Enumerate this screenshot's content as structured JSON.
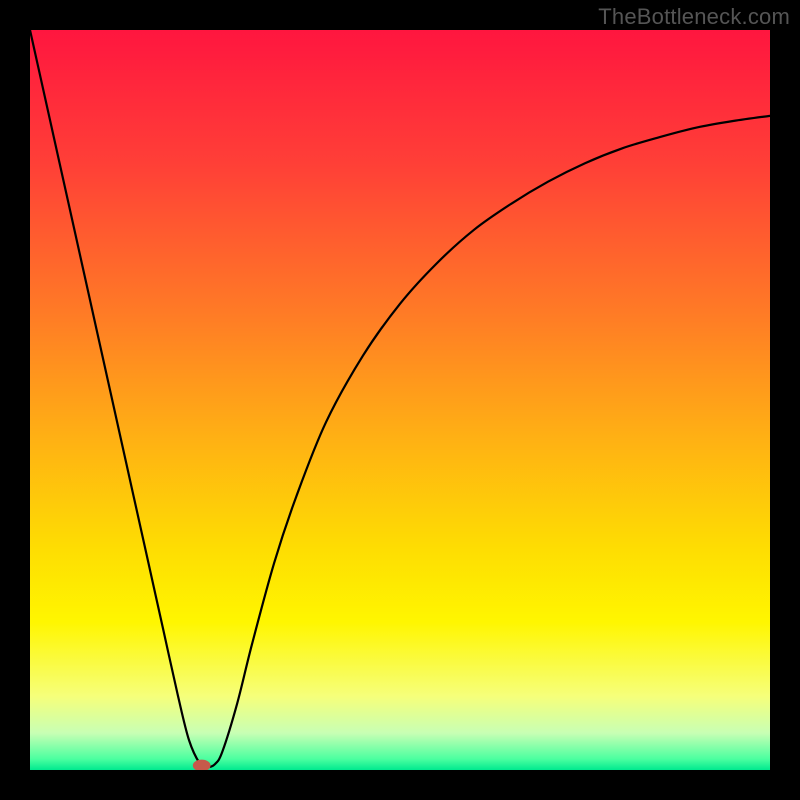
{
  "watermark": "TheBottleneck.com",
  "chart_data": {
    "type": "line",
    "title": "",
    "xlabel": "",
    "ylabel": "",
    "xlim": [
      0,
      100
    ],
    "ylim": [
      0,
      100
    ],
    "gradient_stops": [
      {
        "offset": 0.0,
        "color": "#ff163f"
      },
      {
        "offset": 0.18,
        "color": "#ff3f37"
      },
      {
        "offset": 0.38,
        "color": "#ff7a26"
      },
      {
        "offset": 0.55,
        "color": "#ffb014"
      },
      {
        "offset": 0.7,
        "color": "#fedd02"
      },
      {
        "offset": 0.8,
        "color": "#fff600"
      },
      {
        "offset": 0.9,
        "color": "#f6ff7a"
      },
      {
        "offset": 0.95,
        "color": "#c8ffb4"
      },
      {
        "offset": 0.985,
        "color": "#4cffa0"
      },
      {
        "offset": 1.0,
        "color": "#00e98f"
      }
    ],
    "series": [
      {
        "name": "bottleneck-curve",
        "x": [
          0.0,
          2.0,
          4.0,
          6.0,
          8.0,
          10.0,
          12.0,
          14.0,
          16.0,
          18.0,
          20.0,
          21.5,
          23.0,
          24.0,
          25.0,
          26.0,
          28.0,
          30.0,
          33.0,
          36.0,
          40.0,
          45.0,
          50.0,
          55.0,
          60.0,
          65.0,
          70.0,
          75.0,
          80.0,
          85.0,
          90.0,
          95.0,
          100.0
        ],
        "y": [
          100.0,
          91.0,
          82.0,
          73.0,
          64.0,
          55.0,
          46.0,
          37.0,
          28.0,
          19.0,
          10.0,
          4.0,
          0.8,
          0.4,
          0.8,
          2.5,
          9.0,
          17.0,
          28.0,
          37.0,
          47.0,
          56.0,
          63.0,
          68.5,
          73.0,
          76.5,
          79.5,
          82.0,
          84.0,
          85.5,
          86.8,
          87.7,
          88.4
        ]
      }
    ],
    "marker": {
      "x": 23.2,
      "y": 0.6,
      "rx": 1.2,
      "ry": 0.8,
      "color": "#c65a4a"
    }
  }
}
